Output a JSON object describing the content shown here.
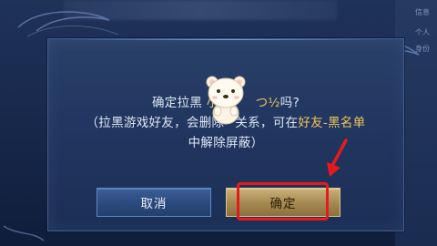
{
  "background": {
    "right_panel_items": [
      "信息",
      "个人",
      "身份"
    ]
  },
  "dialog": {
    "line1_prefix": "确定拉黑 ",
    "line1_name": "小",
    "line1_name_tail": "つ½",
    "line1_suffix": "吗?",
    "line2_prefix": "（拉黑游戏好友，会删除",
    "line2_mid": "关系，可在",
    "line2_highlight": "好友-黑名单",
    "line3": "中解除屏蔽）",
    "cancel_label": "取消",
    "confirm_label": "确定"
  },
  "colors": {
    "dialog_bg": "#213660",
    "highlight_text": "#f2c55a",
    "confirm_button": "#a88b52",
    "cancel_button": "#2b4a7e",
    "annotation_red": "#e8191c"
  }
}
